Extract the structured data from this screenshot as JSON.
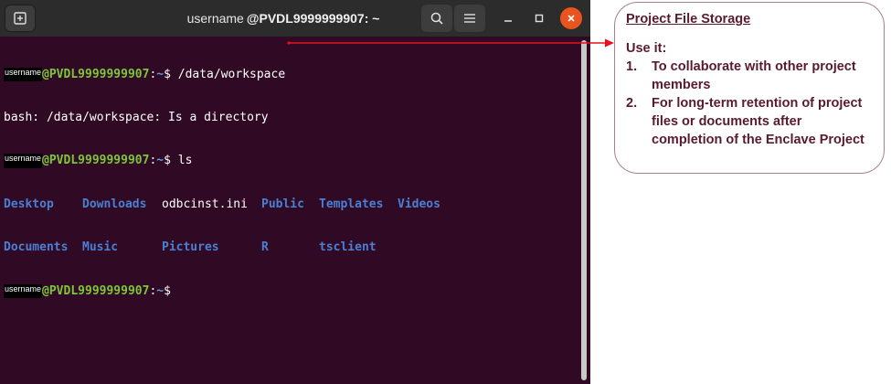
{
  "window": {
    "title_user": "username",
    "title_host": "@PVDL9999999907: ~"
  },
  "terminal": {
    "prompt": {
      "user": "username",
      "host": "@PVDL9999999907",
      "sep": ":",
      "path": "~",
      "dollar": "$"
    },
    "lines": {
      "cmd1": " /data/workspace",
      "out1": "bash: /data/workspace: Is a directory",
      "cmd2": " ls"
    },
    "ls_rows": [
      [
        "Desktop",
        "Downloads",
        "odbcinst.ini",
        "Public",
        "Templates",
        "Videos"
      ],
      [
        "Documents",
        "Music",
        "Pictures",
        "R",
        "tsclient",
        ""
      ]
    ]
  },
  "callout": {
    "title": "Project File Storage",
    "subtitle": "Use it:",
    "items": [
      {
        "num": "1.",
        "text": "To collaborate with other project members"
      },
      {
        "num": "2.",
        "text": "For long-term retention of project files or documents after completion of the Enclave Project"
      }
    ]
  },
  "colors": {
    "terminal_bg": "#300a24",
    "prompt_host": "#7dc63a",
    "ls_dir": "#4a7fd4",
    "callout_text": "#5a1a2e",
    "arrow": "#e8101c",
    "close_button": "#e95420"
  }
}
